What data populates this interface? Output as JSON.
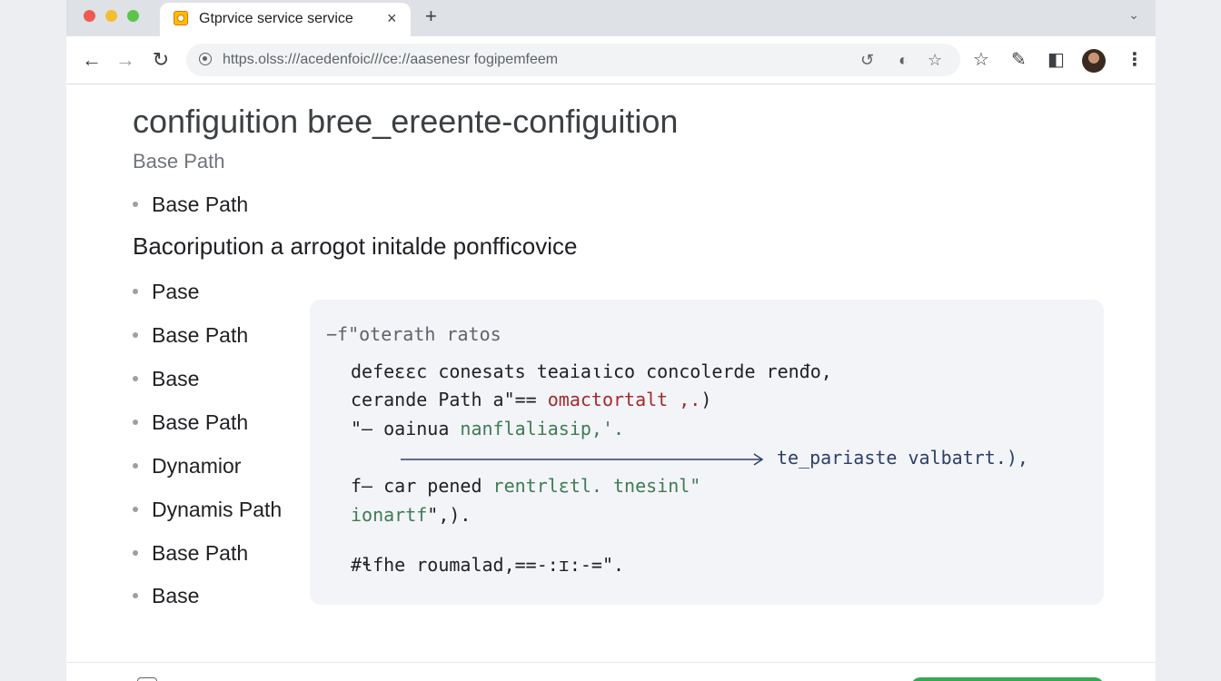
{
  "browser": {
    "tab": {
      "title": "Gtprvice service service",
      "favicon": "service-favicon",
      "close_label": "×"
    },
    "new_tab_label": "+",
    "corner_label": "⌄",
    "nav": {
      "back": "←",
      "forward": "→",
      "reload": "↻"
    },
    "address": {
      "url": "https.olss:///acedenfoic///ce://aasenesr fogipemfeem",
      "translate_icon": "↺",
      "shield_icon": "◐",
      "star_icon": "☆"
    },
    "toolbar_icons": {
      "bookmark": "☆",
      "edit": "✎",
      "split": "◧",
      "menu": "⋮"
    }
  },
  "page": {
    "title": "configuition  bree_ereente-configuition",
    "subtitle": "Base Path",
    "intro_bullet": "Base Path",
    "section_heading": "Bacoripution a  arrogot initalde ponfficovice",
    "list": [
      "Pase",
      "Base Path",
      "Base",
      "Base Path",
      "Dynamior",
      "Dynamis Path",
      "Base Path",
      "Base"
    ]
  },
  "code": {
    "line1": "−f\"oterath ratos",
    "line2": "defeεεc conesats teaiaιico concolerde renđo,",
    "line3a": "cerande Path a\"== ",
    "line3b": "omactortalt ,.",
    "line3c": ")",
    "line4a": "\"— oainua ",
    "line4b": "nanflaliasip,'.",
    "line5": "te_pariaste valbatrt.),",
    "line6a": "f— car pened ",
    "line6b": "rentrlεtl. tnesinl\"",
    "line7a": "ionartf",
    "line7b": "\",).",
    "line8": "#ɬfhe roumalad,==-:ɪ:-=\"."
  },
  "colors": {
    "accent_red": "#a52a2a",
    "accent_green": "#3e7b54",
    "accent_blue": "#2c3e6a",
    "footer_button": "#34a853"
  }
}
